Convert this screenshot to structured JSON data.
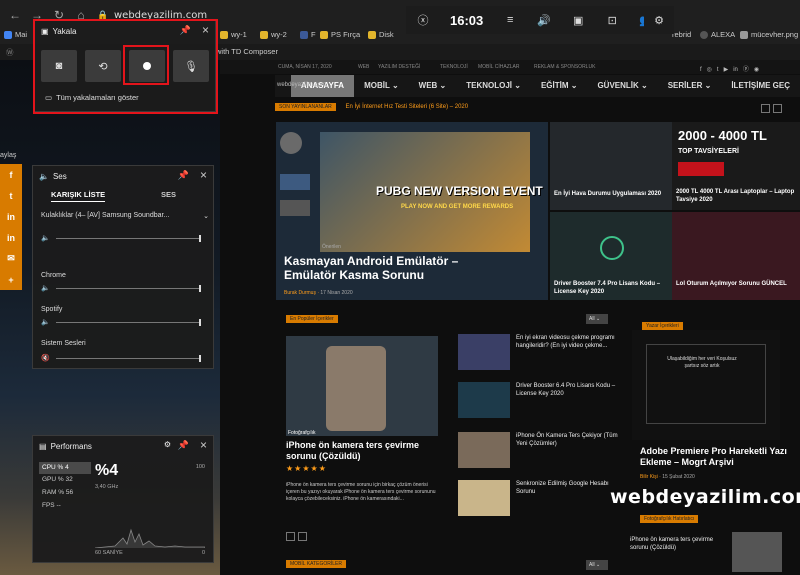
{
  "browser": {
    "url": "webdeyazilim.com",
    "bookmarks": [
      "Mai",
      "wy-1",
      "wy-2",
      "F",
      "PS Fırça",
      "Disk",
      "rebrid",
      "ALEXA",
      "mücevher.png"
    ],
    "bookmarks_row2": "with TD Composer"
  },
  "gamebar": {
    "time": "16:03"
  },
  "capture": {
    "title": "Yakala",
    "show_all": "Tüm yakalamaları göster"
  },
  "audio": {
    "title": "Ses",
    "tab_mix": "KARIŞIK LİSTE",
    "tab_voice": "SES",
    "device": "Kulaklıklar (4– [AV] Samsung Soundbar...",
    "apps": [
      "Chrome",
      "Spotify",
      "Sistem Sesleri"
    ]
  },
  "performance": {
    "title": "Performans",
    "stats": [
      "CPU % 4",
      "GPU % 32",
      "RAM % 56",
      "FPS  --"
    ],
    "big_value": "%4",
    "freq": "3,40 GHz",
    "max": "100",
    "min": "0",
    "window": "60 SANİYE"
  },
  "share": {
    "label": "aylaş",
    "icons": [
      "f",
      "t",
      "in",
      "in",
      "✉",
      "+"
    ]
  },
  "site": {
    "topbar": "CUMA, NİSAN 17, 2020",
    "topbar_links": [
      "WEB",
      "YAZILIM DESTEĞİ",
      "TEKNOLOJİ",
      "MOBİL CİHAZLAR",
      "REKLAM & SPONSORLUK"
    ],
    "logo": "webdeyazilim.com",
    "nav": [
      "ANASAYFA",
      "MOBİL ⌄",
      "WEB ⌄",
      "TEKNOLOJİ ⌄",
      "EĞİTİM ⌄",
      "GÜVENLİK ⌄",
      "SERİLER ⌄",
      "İLETİŞİME GEÇ"
    ],
    "ticker_badge": "SON YAYINLANANLAR",
    "ticker_text": "En İyi İnternet Hız Testi Siteleri (6 Site) – 2020",
    "hero_banner": "PUBG NEW VERSION EVENT",
    "hero_sub": "PLAY NOW AND GET MORE REWARDS",
    "hero_tag": "Önerilen",
    "hero_title": "Kasmayan Android Emülatör – Emülatör Kasma Sorunu",
    "hero_author": "Burak Durmuş",
    "hero_date": "17 Nisan 2020",
    "side1": "En İyi Hava Durumu Uygulaması 2020",
    "side2_big": "2000 - 4000 TL",
    "side2_sub": "TOP TAVSİYELERİ",
    "side2": "2000 TL 4000 TL Arası Laptoplar – Laptop Tavsiye 2020",
    "side3": "Driver Booster 7.4 Pro Lisans Kodu – License Key 2020",
    "side4": "Lol Oturum Açılmıyor Sorunu GÜNCEL",
    "section_badge": "En Popüler İçerikler",
    "select": "All",
    "feature_tag": "Fotoğrafçılık",
    "feature_title": "iPhone ön kamera ters çevirme sorunu (Çözüldü)",
    "feature_rating": "★★★★★",
    "feature_excerpt": "iPhone ön kamera ters çevirme sorunu için birkaç çözüm önerisi içeren bu yazıyı okuyarak iPhone ön kamera ters çevirme sorununu kolayca çözebileceksiniz. iPhone ön kamerasındaki...",
    "list": [
      "En iyi ekran videosu çekme programı hangileridir? (En iyi video çekme...",
      "Driver Booster 6.4 Pro Lisans Kodu – License Key 2020",
      "iPhone Ön Kamera Ters Çekiyor (Tüm Yeni Çözümler)",
      "Senkronize Edilmiş Google Hesabı Sorunu"
    ],
    "right_badge": "Yazar İçerikleri",
    "quote1": "Ulaşabildiğim her veri Koşulsuz şartsız söz artık",
    "right_title": "Adobe Premiere Pro Hareketli Yazı Ekleme – Mogrt Arşivi",
    "right_author": "Bilir Kişi",
    "right_date": "15 Şubat 2020",
    "right2_badge": "Fotoğrafçılık Hatırlatıcı",
    "right2_title": "iPhone ön kamera ters çevirme sorunu (Çözüldü)",
    "footer_badge": "MOBİL KATEGORİLER",
    "watermark": "webdeyazilim.com"
  },
  "colors": {
    "accent": "#d87b00",
    "red_highlight": "#e3141b"
  }
}
